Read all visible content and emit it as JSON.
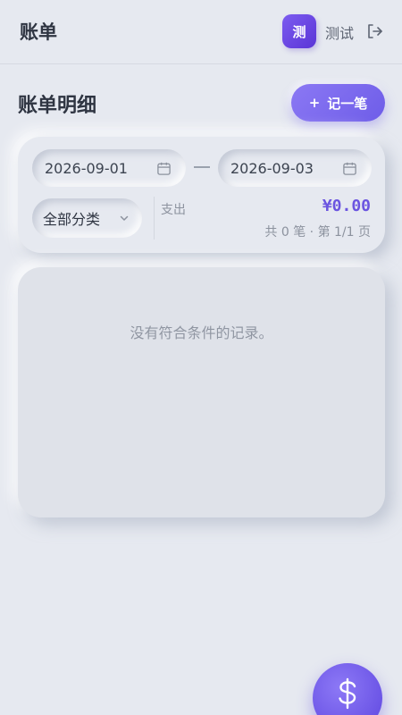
{
  "header": {
    "title": "账单",
    "avatar_text": "测",
    "username": "测试",
    "logout_icon": "logout-icon"
  },
  "page": {
    "title": "账单明细",
    "add_button_plus": "+",
    "add_button_label": "记一笔"
  },
  "filters": {
    "start_date": "2026-09-01",
    "end_date": "2026-09-03",
    "category": "全部分类"
  },
  "summary": {
    "label": "支出",
    "amount": "¥0.00",
    "meta": "共 0 笔 · 第 1/1 页"
  },
  "records": {
    "empty_message": "没有符合条件的记录。"
  },
  "fab": {
    "icon": "dollar-icon"
  },
  "colors": {
    "accent": "#6e5de8",
    "background": "#e6e9f0",
    "amount": "#6b55e0"
  }
}
